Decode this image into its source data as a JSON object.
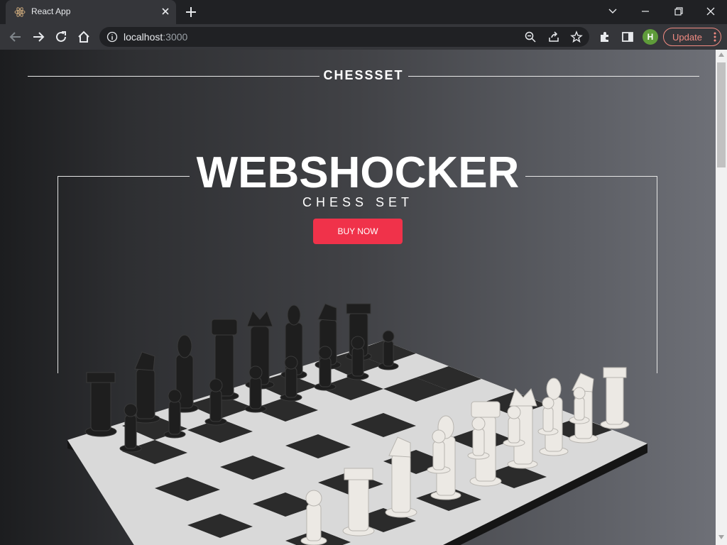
{
  "browser": {
    "tab_title": "React App",
    "url_host": "localhost",
    "url_port": ":3000",
    "profile_initial": "H",
    "update_label": "Update"
  },
  "page": {
    "brand": "CHESSSET",
    "hero_title": "WEBSHOCKER",
    "hero_subtitle": "CHESS SET",
    "cta_label": "BUY NOW"
  },
  "colors": {
    "accent": "#f0324a",
    "profile": "#5f9c3a",
    "update": "#f28b82"
  },
  "icons": [
    "react-favicon",
    "close-icon",
    "plus-icon",
    "chevron-down-icon",
    "minimize-icon",
    "restore-icon",
    "window-close-icon",
    "back-icon",
    "forward-icon",
    "reload-icon",
    "home-icon",
    "info-icon",
    "zoom-icon",
    "share-icon",
    "star-icon",
    "extensions-icon",
    "side-panel-icon",
    "more-icon"
  ]
}
